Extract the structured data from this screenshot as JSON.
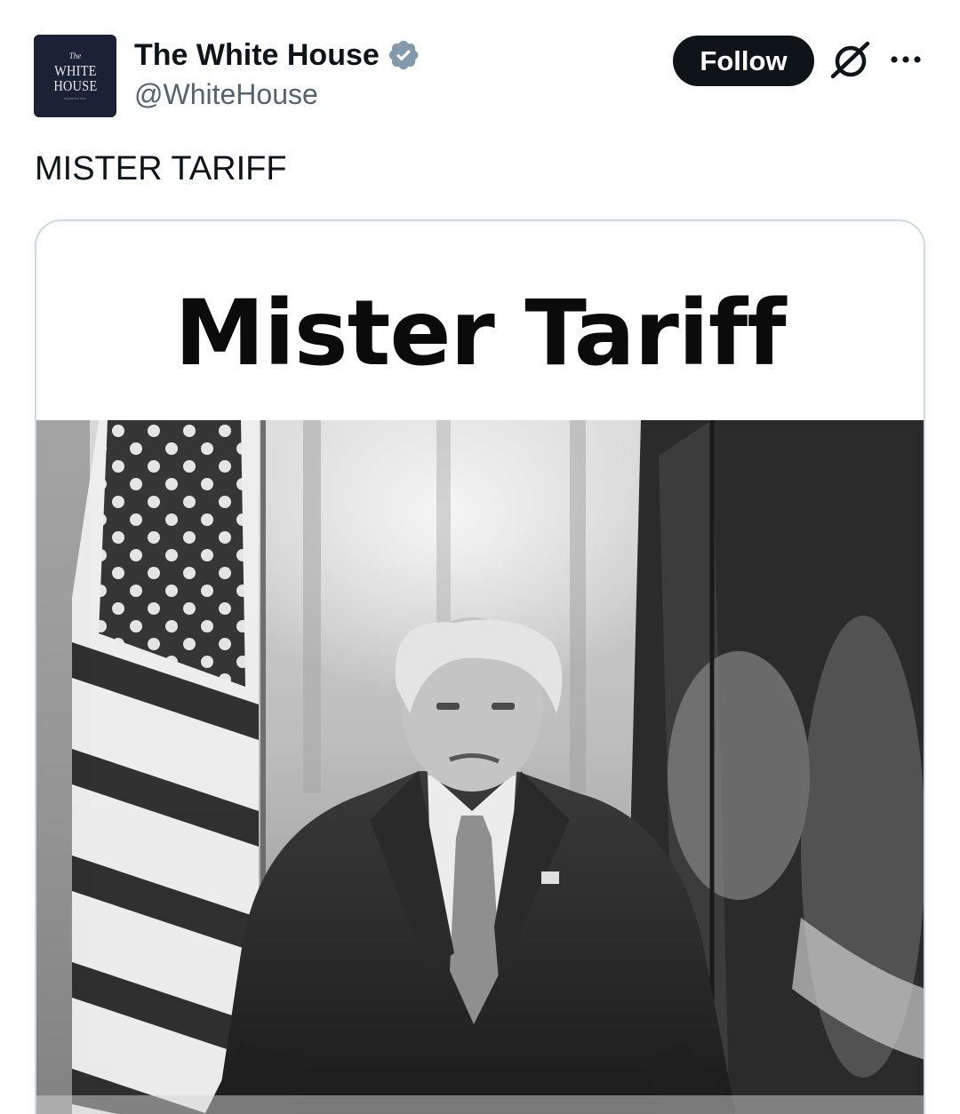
{
  "author": {
    "display_name": "The White House",
    "handle": "@WhiteHouse",
    "avatar_text": {
      "top": "The",
      "line1": "WHITE",
      "line2": "HOUSE",
      "bottom": "WASHINGTON"
    },
    "verified_color": "#829aab"
  },
  "actions": {
    "follow_label": "Follow",
    "grok_icon": "grok-icon",
    "more_icon": "more-icon"
  },
  "tweet": {
    "text": "MISTER TARIFF"
  },
  "media": {
    "headline": "Mister Tariff",
    "photo_style": "black-and-white"
  },
  "colors": {
    "text_primary": "#0f1419",
    "text_secondary": "#536471",
    "border": "#cfd9de",
    "button_bg": "#0f1419"
  }
}
